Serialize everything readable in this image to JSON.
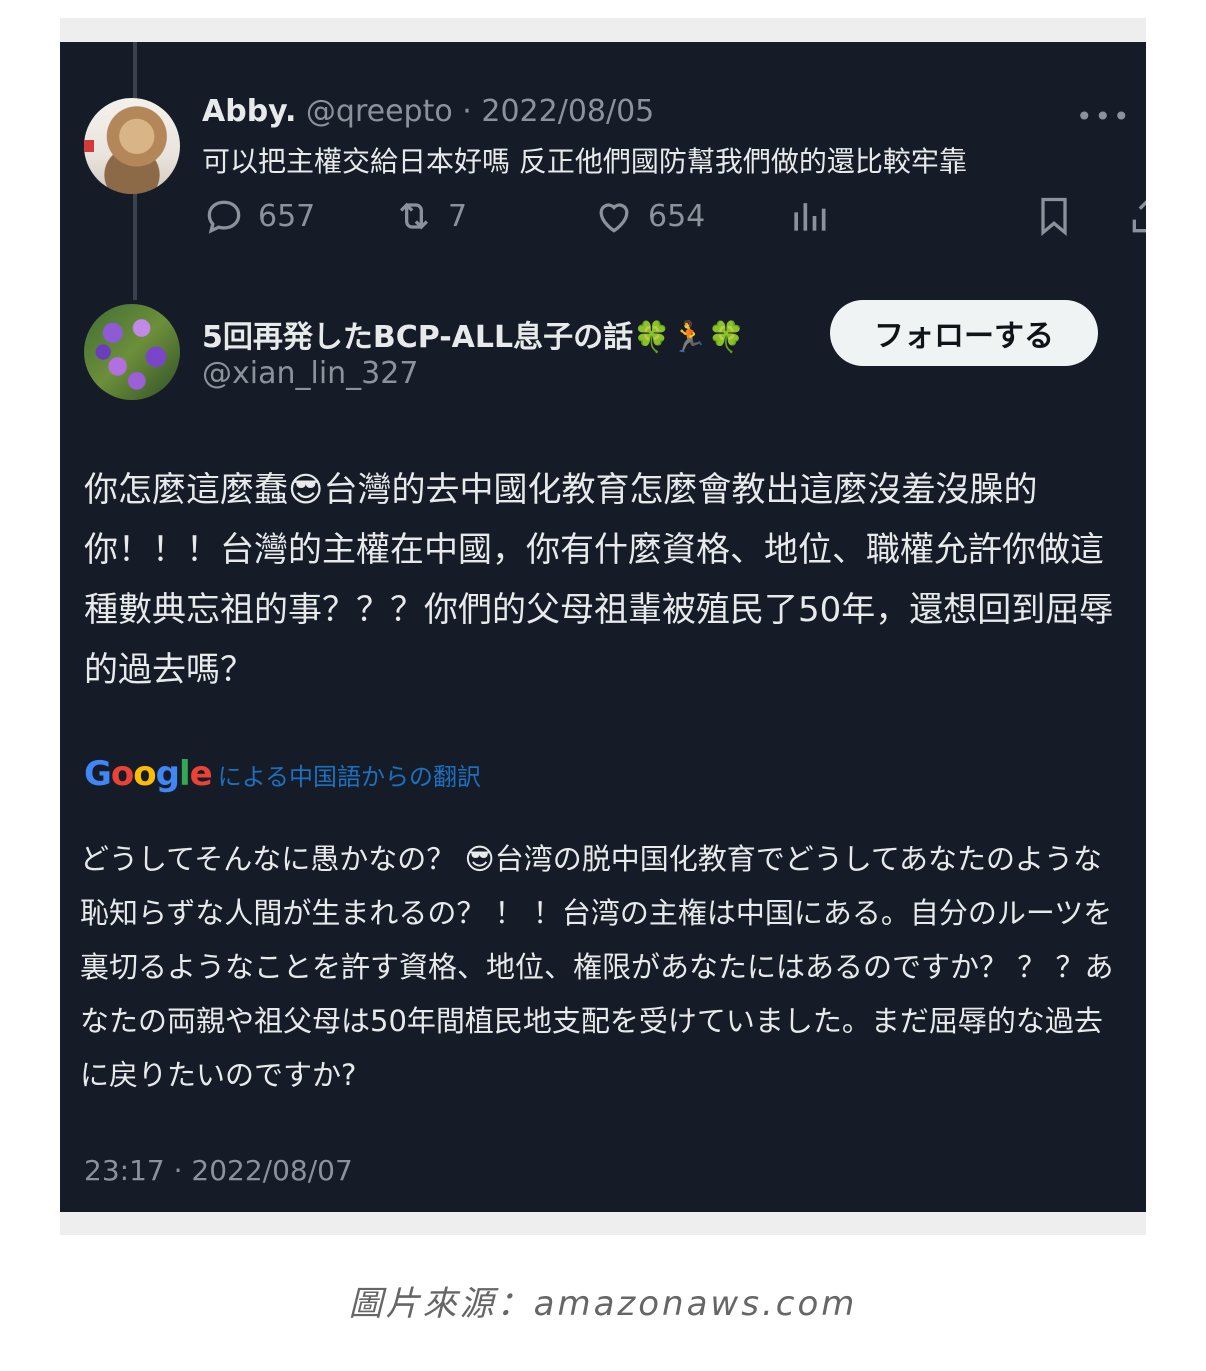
{
  "tweet1": {
    "display_name": "Abby.",
    "handle": "@qreepto",
    "separator": "·",
    "date": "2022/08/05",
    "text": "可以把主權交給日本好嗎 反正他們國防幫我們做的還比較牢靠",
    "more_icon": "more-dots-icon",
    "replies": "657",
    "retweets": "7",
    "likes": "654"
  },
  "tweet2": {
    "display_name": "5回再発したBCP-ALL息子の話🍀🏃🍀",
    "handle": "@xian_lin_327",
    "follow_label": "フォローする",
    "text": "你怎麼這麼蠢😎台灣的去中國化教育怎麼會教出這麼沒羞沒臊的你！！！台灣的主權在中國，你有什麼資格、地位、職權允許你做這種數典忘祖的事？？？你們的父母祖輩被殖民了50年，還想回到屈辱的過去嗎？",
    "translation_brand": "Google",
    "translation_label": "による中国語からの翻訳",
    "translation": "どうしてそんなに愚かなの？ 😎台湾の脱中国化教育でどうしてあなたのような恥知らずな人間が生まれるの？ ！ ！台湾の主権は中国にある。自分のルーツを裏切るようなことを許す資格、地位、権限があなたにはあるのですか？ ？ ？あなたの両親や祖父母は50年間植民地支配を受けていました。まだ屈辱的な過去に戻りたいのですか?",
    "timestamp": "23:17 · 2022/08/07"
  },
  "caption": "圖片來源：amazonaws.com",
  "colors": {
    "background": "#151c27",
    "text": "#e7e9ea",
    "muted": "#8a929b",
    "google_blue": "#4285f4",
    "google_red": "#ea4335",
    "google_yellow": "#fbbc05",
    "google_green": "#34a853"
  }
}
